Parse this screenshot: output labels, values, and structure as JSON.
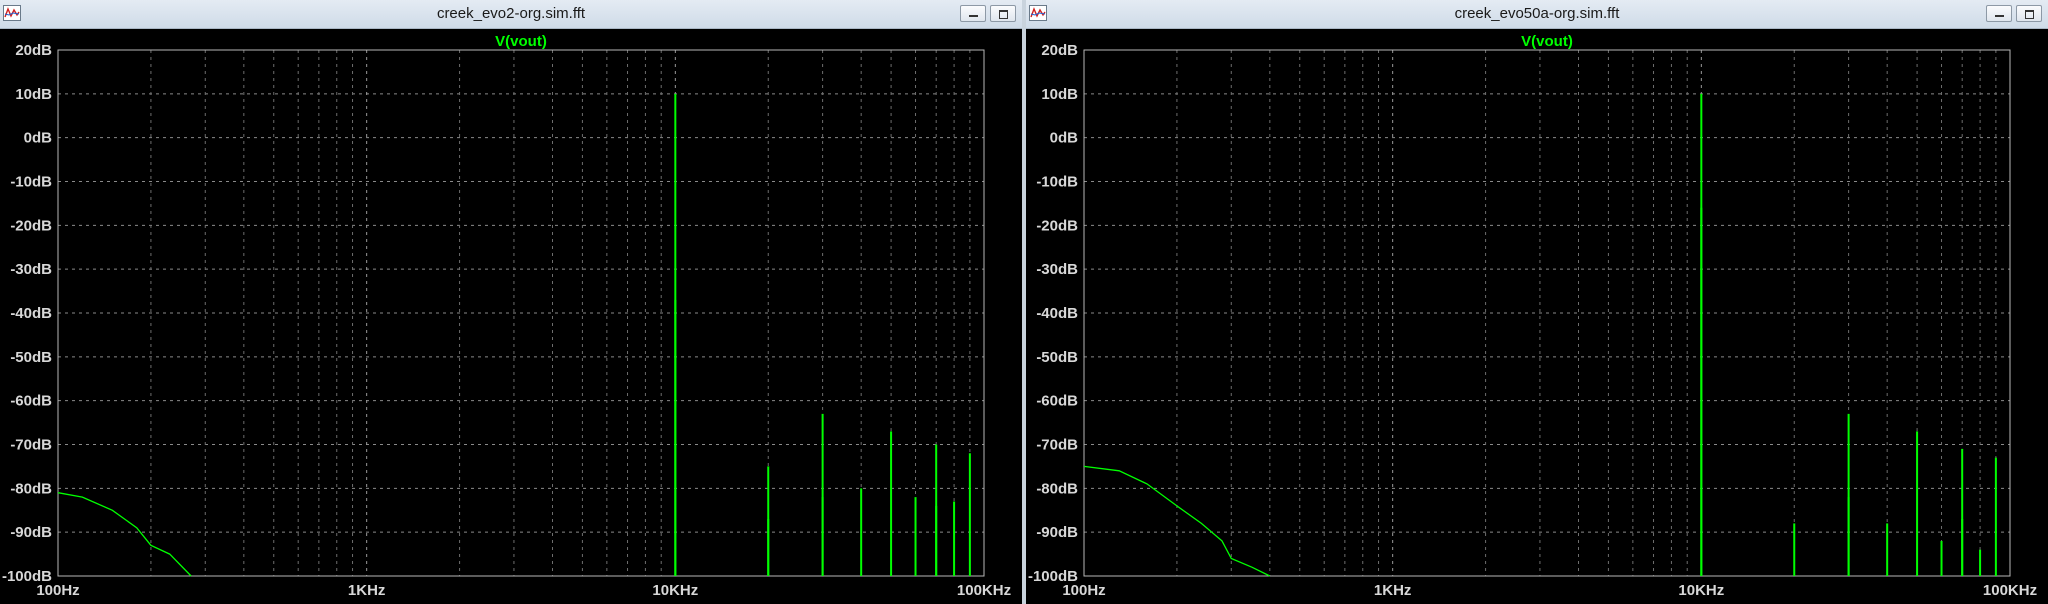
{
  "windows": [
    {
      "title": "creek_evo2-org.sim.fft",
      "trace_label": "V(vout)",
      "y_ticks": [
        "20dB",
        "10dB",
        "0dB",
        "-10dB",
        "-20dB",
        "-30dB",
        "-40dB",
        "-50dB",
        "-60dB",
        "-70dB",
        "-80dB",
        "-90dB",
        "-100dB"
      ],
      "x_ticks": [
        "100Hz",
        "1KHz",
        "10KHz",
        "100KHz"
      ]
    },
    {
      "title": "creek_evo50a-org.sim.fft",
      "trace_label": "V(vout)",
      "y_ticks": [
        "20dB",
        "10dB",
        "0dB",
        "-10dB",
        "-20dB",
        "-30dB",
        "-40dB",
        "-50dB",
        "-60dB",
        "-70dB",
        "-80dB",
        "-90dB",
        "-100dB"
      ],
      "x_ticks": [
        "100Hz",
        "1KHz",
        "10KHz",
        "100KHz"
      ]
    }
  ],
  "chart_data": [
    {
      "type": "line",
      "xscale": "log",
      "xlim": [
        100,
        100000
      ],
      "ylim": [
        -100,
        20
      ],
      "grid": true,
      "trace_color": "#00ff00",
      "noise_floor": {
        "x": [
          100,
          120,
          150,
          180,
          200,
          230,
          270
        ],
        "y": [
          -81,
          -82,
          -85,
          -89,
          -93,
          -95,
          -100
        ]
      },
      "spikes": [
        {
          "x": 10000,
          "y": 10
        },
        {
          "x": 10000,
          "y": -37
        },
        {
          "x": 20000,
          "y": -75
        },
        {
          "x": 20000,
          "y": -87
        },
        {
          "x": 30000,
          "y": -63
        },
        {
          "x": 30000,
          "y": -82
        },
        {
          "x": 40000,
          "y": -80
        },
        {
          "x": 50000,
          "y": -67
        },
        {
          "x": 60000,
          "y": -82
        },
        {
          "x": 70000,
          "y": -70
        },
        {
          "x": 70000,
          "y": -84
        },
        {
          "x": 80000,
          "y": -83
        },
        {
          "x": 90000,
          "y": -72
        }
      ]
    },
    {
      "type": "line",
      "xscale": "log",
      "xlim": [
        100,
        100000
      ],
      "ylim": [
        -100,
        20
      ],
      "grid": true,
      "trace_color": "#00ff00",
      "noise_floor": {
        "x": [
          100,
          130,
          160,
          200,
          240,
          280,
          300,
          350,
          400
        ],
        "y": [
          -75,
          -76,
          -79,
          -84,
          -88,
          -92,
          -96,
          -98,
          -100
        ]
      },
      "spikes": [
        {
          "x": 10000,
          "y": 10
        },
        {
          "x": 10000,
          "y": -16
        },
        {
          "x": 20000,
          "y": -88
        },
        {
          "x": 30000,
          "y": -63
        },
        {
          "x": 30000,
          "y": -82
        },
        {
          "x": 40000,
          "y": -88
        },
        {
          "x": 50000,
          "y": -67
        },
        {
          "x": 60000,
          "y": -92
        },
        {
          "x": 70000,
          "y": -71
        },
        {
          "x": 70000,
          "y": -87
        },
        {
          "x": 80000,
          "y": -94
        },
        {
          "x": 90000,
          "y": -73
        }
      ]
    }
  ]
}
